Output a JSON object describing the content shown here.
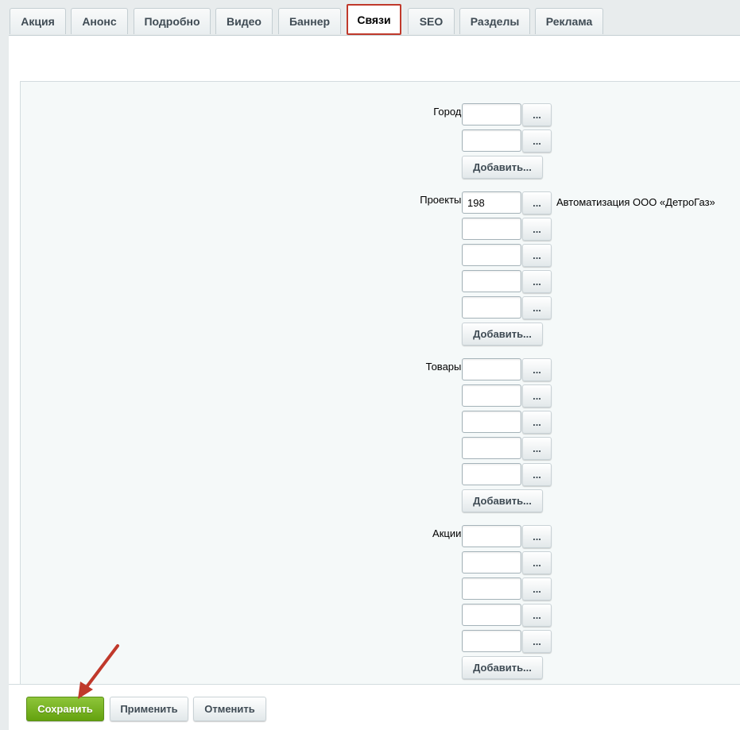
{
  "tabs": [
    "Акция",
    "Анонс",
    "Подробно",
    "Видео",
    "Баннер",
    "Связи",
    "SEO",
    "Разделы",
    "Реклама"
  ],
  "active_tab": "Связи",
  "fields": {
    "city": {
      "label": "Город:",
      "values": [
        "",
        ""
      ],
      "add_label": "Добавить..."
    },
    "projects": {
      "label": "Проекты:",
      "values": [
        "198",
        "",
        "",
        "",
        ""
      ],
      "first_description": "Автоматизация ООО «ДетроГаз»",
      "add_label": "Добавить..."
    },
    "goods": {
      "label": "Товары:",
      "values": [
        "",
        "",
        "",
        "",
        ""
      ],
      "add_label": "Добавить..."
    },
    "promos": {
      "label": "Акции:",
      "values": [
        "",
        "",
        "",
        "",
        ""
      ],
      "add_label": "Добавить..."
    }
  },
  "picker_button_label": "...",
  "footer": {
    "save": "Сохранить",
    "apply": "Применить",
    "cancel": "Отменить"
  },
  "colors": {
    "active_tab_outline": "#c0392b",
    "save_button": "#7ab32a",
    "arrow": "#c0392b"
  }
}
